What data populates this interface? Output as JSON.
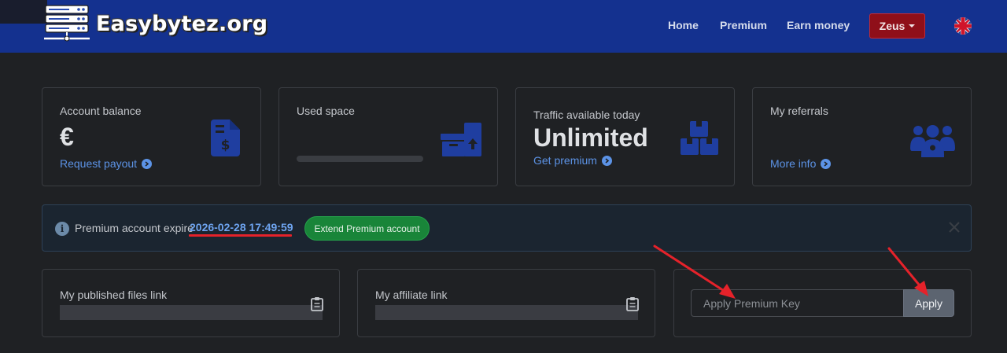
{
  "header": {
    "brand": "Easybytez.org",
    "nav": [
      {
        "label": "Home"
      },
      {
        "label": "Premium"
      },
      {
        "label": "Earn money"
      }
    ],
    "user_label": "Zeus",
    "language_icon": "uk-flag-icon"
  },
  "cards": {
    "account_balance": {
      "title": "Account balance",
      "value": "€",
      "link": "Request payout",
      "icon": "invoice-dollar-icon"
    },
    "used_space": {
      "title": "Used space",
      "progress_fraction": 0.0,
      "icon": "archive-upload-icon"
    },
    "traffic": {
      "title": "Traffic available today",
      "value": "Unlimited",
      "link": "Get premium",
      "icon": "boxes-icon"
    },
    "referrals": {
      "title": "My referrals",
      "link": "More info",
      "icon": "users-icon"
    }
  },
  "alert": {
    "text": "Premium account expire",
    "expire_date": "2026-02-28 17:49:59",
    "extend_label": "Extend Premium account"
  },
  "links": {
    "published_title": "My published files link",
    "affiliate_title": "My affiliate link"
  },
  "premium_key": {
    "placeholder": "Apply Premium Key",
    "apply_label": "Apply"
  },
  "colors": {
    "navbar": "#14318f",
    "user_button": "#8f0f19",
    "accent_link": "#5c93e6",
    "extend_button": "#198539",
    "annotation_red": "#e5222a"
  }
}
